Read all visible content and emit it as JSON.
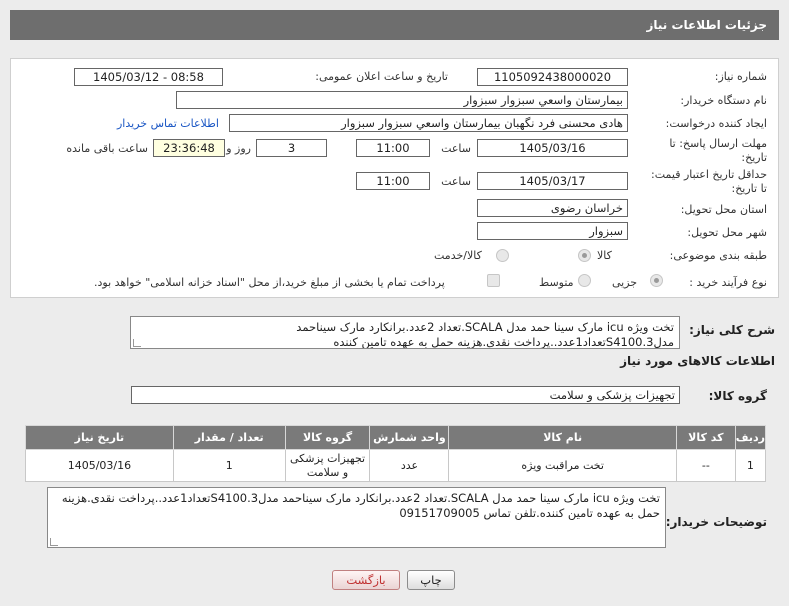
{
  "header": {
    "title": "جزئیات اطلاعات نیاز"
  },
  "form": {
    "need_number": {
      "label": "شماره نیاز:",
      "value": "1105092438000020"
    },
    "announce_datetime": {
      "label": "تاریخ و ساعت اعلان عمومی:",
      "value": "1405/03/12 - 08:58"
    },
    "buyer_org": {
      "label": "نام دستگاه خریدار:",
      "value": "بیمارستان واسعي سبزوار سبزوار"
    },
    "creator": {
      "label": "ایجاد کننده درخواست:",
      "value": "هادی محسنی فرد نگهبان بیمارستان واسعي سبزوار سبزوار"
    },
    "contact_link": "اطلاعات تماس خریدار",
    "reply_deadline": {
      "label_line1": "مهلت ارسال پاسخ: تا",
      "label_line2": "تاریخ:",
      "date": "1405/03/16",
      "time_label": "ساعت",
      "time": "11:00",
      "days": "3",
      "days_label": "روز و",
      "remaining": "23:36:48",
      "remaining_label": "ساعت باقی مانده"
    },
    "price_validity": {
      "label_line1": "حداقل تاریخ اعتبار قیمت:",
      "label_line2": "تا تاریخ:",
      "date": "1405/03/17",
      "time_label": "ساعت",
      "time": "11:00"
    },
    "delivery_province": {
      "label": "استان محل تحویل:",
      "value": "خراسان رضوی"
    },
    "delivery_city": {
      "label": "شهر محل تحویل:",
      "value": "سبزوار"
    },
    "category": {
      "label": "طبقه بندی موضوعی:",
      "options": [
        "کالا",
        "کالا/خدمت"
      ],
      "selected": "کالا"
    },
    "purchase_process": {
      "label": "نوع فرآیند خرید :",
      "options": [
        "جزیی",
        "متوسط"
      ],
      "selected": "جزیی",
      "payment_note": "پرداخت تمام یا بخشی از مبلغ خرید،از محل \"اسناد خزانه اسلامی\" خواهد بود."
    }
  },
  "summary": {
    "label": "شرح کلی نیاز:",
    "text": "تخت ویژه icu مارک سینا حمد مدل SCALA.تعداد 2عدد.برانکارد مارک سیناحمد مدلS4100.3تعداد1عدد..پرداخت نقدی.هزینه حمل به عهده تامین کننده"
  },
  "goods_info": {
    "heading": "اطلاعات کالاهای مورد نیاز",
    "group_label": "گروه کالا:",
    "group_value": "تجهیزات پزشکی و سلامت"
  },
  "table": {
    "headers": [
      "ردیف",
      "کد کالا",
      "نام کالا",
      "واحد شمارش",
      "گروه کالا",
      "تعداد / مقدار",
      "تاریخ نیاز"
    ],
    "rows": [
      [
        "1",
        "--",
        "تخت مراقبت ویژه",
        "عدد",
        "تجهیزات پزشکی و سلامت",
        "1",
        "1405/03/16"
      ]
    ]
  },
  "buyer_notes": {
    "label": "توضیحات خریدار:",
    "text": "تخت ویژه icu مارک سینا حمد مدل SCALA.تعداد 2عدد.برانکارد مارک سیناحمد مدلS4100.3تعداد1عدد..پرداخت نقدی.هزینه حمل به عهده تامین کننده.تلفن تماس 09151709005"
  },
  "buttons": {
    "print": "چاپ",
    "back": "بازگشت"
  },
  "watermark": "AriaTender.net"
}
